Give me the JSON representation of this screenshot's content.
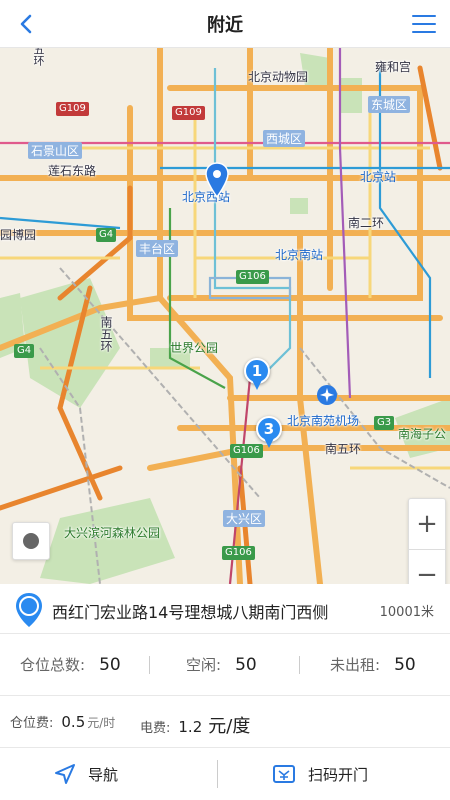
{
  "header": {
    "title": "附近",
    "accent": "#2a7ae2"
  },
  "map": {
    "labels": {
      "beijing_zoo": "北京动物园",
      "yonghegong": "雍和宫",
      "dongcheng": "东城区",
      "xicheng": "西城区",
      "shijingshan": "石景山区",
      "lianshidong": "莲石东路",
      "beijing_station": "北京站",
      "beijing_west": "北京西站",
      "yuanbo": "园博园",
      "fengtai": "丰台区",
      "beijing_south": "北京南站",
      "south_2nd_ring": "南二环",
      "south_5th_ring_left": "南五环",
      "shijie_park": "世界公园",
      "nanyuan_airport": "北京南苑机场",
      "nanhaizi": "南海子公",
      "south_5th_ring_right": "南五环",
      "daxing": "大兴区",
      "daxing_forest": "大兴滨河森林公园",
      "top_left": "五环"
    },
    "roads": {
      "g109_a": "G109",
      "g109_b": "G109",
      "g4_a": "G4",
      "g4_b": "G4",
      "g106_a": "G106",
      "g106_b": "G106",
      "g106_c": "G106",
      "g3": "G3"
    },
    "markers": [
      "1",
      "3"
    ],
    "zoom_in": "+",
    "zoom_out": "−"
  },
  "station": {
    "address": "西红门宏业路14号理想城八期南门西侧",
    "distance": "10001米",
    "stats": [
      {
        "label": "仓位总数:",
        "value": "50"
      },
      {
        "label": "空闲:",
        "value": "50"
      },
      {
        "label": "未出租:",
        "value": "50"
      }
    ],
    "fees": {
      "storage_label": "仓位费:",
      "storage_value": "0.5",
      "storage_unit": "元/时",
      "power_label": "电费:",
      "power_value": "1.2",
      "power_unit": "元/度"
    }
  },
  "actions": {
    "navigate": "导航",
    "scan_open": "扫码开门"
  }
}
